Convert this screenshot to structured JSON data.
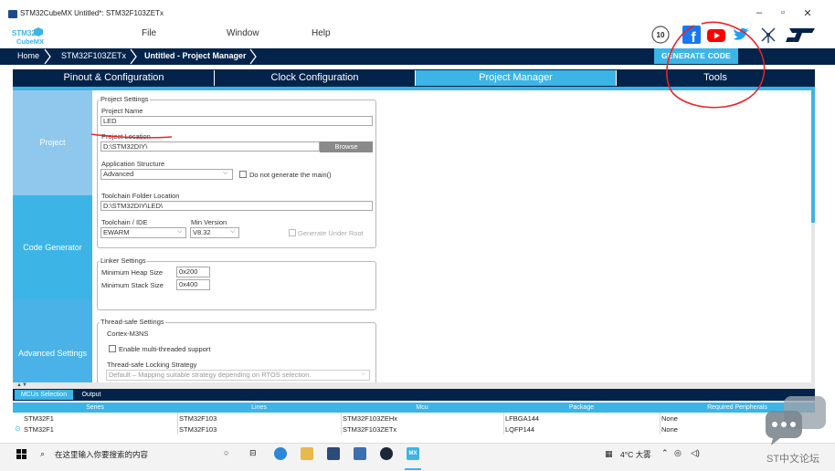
{
  "window": {
    "title": "STM32CubeMX Untitled*: STM32F103ZETx",
    "minimize": "–",
    "maximize": "▫",
    "close": "✕"
  },
  "logo": {
    "line1": "STM32",
    "line2": "CubeMX"
  },
  "menu": [
    "File",
    "Window",
    "Help"
  ],
  "social": {
    "badge": "10",
    "facebook": "f",
    "st": "ST"
  },
  "breadcrumb": [
    "Home",
    "STM32F103ZETx",
    "Untitled - Project Manager"
  ],
  "generate_button": "GENERATE CODE",
  "tabs": [
    {
      "label": "Pinout & Configuration",
      "active": false
    },
    {
      "label": "Clock Configuration",
      "active": false
    },
    {
      "label": "Project Manager",
      "active": true
    },
    {
      "label": "Tools",
      "active": false
    }
  ],
  "sidebar": [
    {
      "label": "Project",
      "color": "#8fc8ec"
    },
    {
      "label": "Code Generator",
      "color": "#3cb4e6"
    },
    {
      "label": "Advanced Settings",
      "color": "#4ab2e6"
    }
  ],
  "project_settings": {
    "legend": "Project Settings",
    "name_label": "Project Name",
    "name_value": "LED",
    "location_label": "Project Location",
    "location_value": "D:\\STM32DIY\\",
    "browse": "Browse",
    "structure_label": "Application Structure",
    "structure_value": "Advanced",
    "no_main_label": "Do not generate the main()",
    "toolchain_folder_label": "Toolchain Folder Location",
    "toolchain_folder_value": "D:\\STM32DIY\\LED\\",
    "toolchain_label": "Toolchain / IDE",
    "toolchain_value": "EWARM",
    "min_version_label": "Min Version",
    "min_version_value": "V8.32",
    "gen_under_root_label": "Generate Under Root"
  },
  "linker_settings": {
    "legend": "Linker Settings",
    "heap_label": "Minimum Heap Size",
    "heap_value": "0x200",
    "stack_label": "Minimum Stack Size",
    "stack_value": "0x400"
  },
  "thread_safe": {
    "legend": "Thread-safe Settings",
    "core": "Cortex-M3NS",
    "enable_label": "Enable multi-threaded support",
    "strategy_label": "Thread-safe Locking Strategy",
    "strategy_value": "Default – Mapping suitable strategy depending on RTOS selection."
  },
  "bottom_tabs": [
    {
      "label": "MCUs Selection",
      "active": true
    },
    {
      "label": "Output",
      "active": false
    }
  ],
  "table": {
    "headers": [
      "Series",
      "Lines",
      "Mcu",
      "Package",
      "Required Peripherals"
    ],
    "rows": [
      {
        "series": "STM32F1",
        "lines": "STM32F103",
        "mcu": "STM32F103ZEHx",
        "package": "LFBGA144",
        "peripherals": "None",
        "selected": false
      },
      {
        "series": "STM32F1",
        "lines": "STM32F103",
        "mcu": "STM32F103ZETx",
        "package": "LQFP144",
        "peripherals": "None",
        "selected": true
      }
    ]
  },
  "taskbar": {
    "search_placeholder": "在这里输入你要搜索的内容",
    "weather": "4°C 大雾",
    "mx_label": "MX"
  },
  "watermark": "ST中文论坛",
  "colors": {
    "navy": "#03234b",
    "accent": "#3cb4e6",
    "annotation": "#e8232a"
  }
}
